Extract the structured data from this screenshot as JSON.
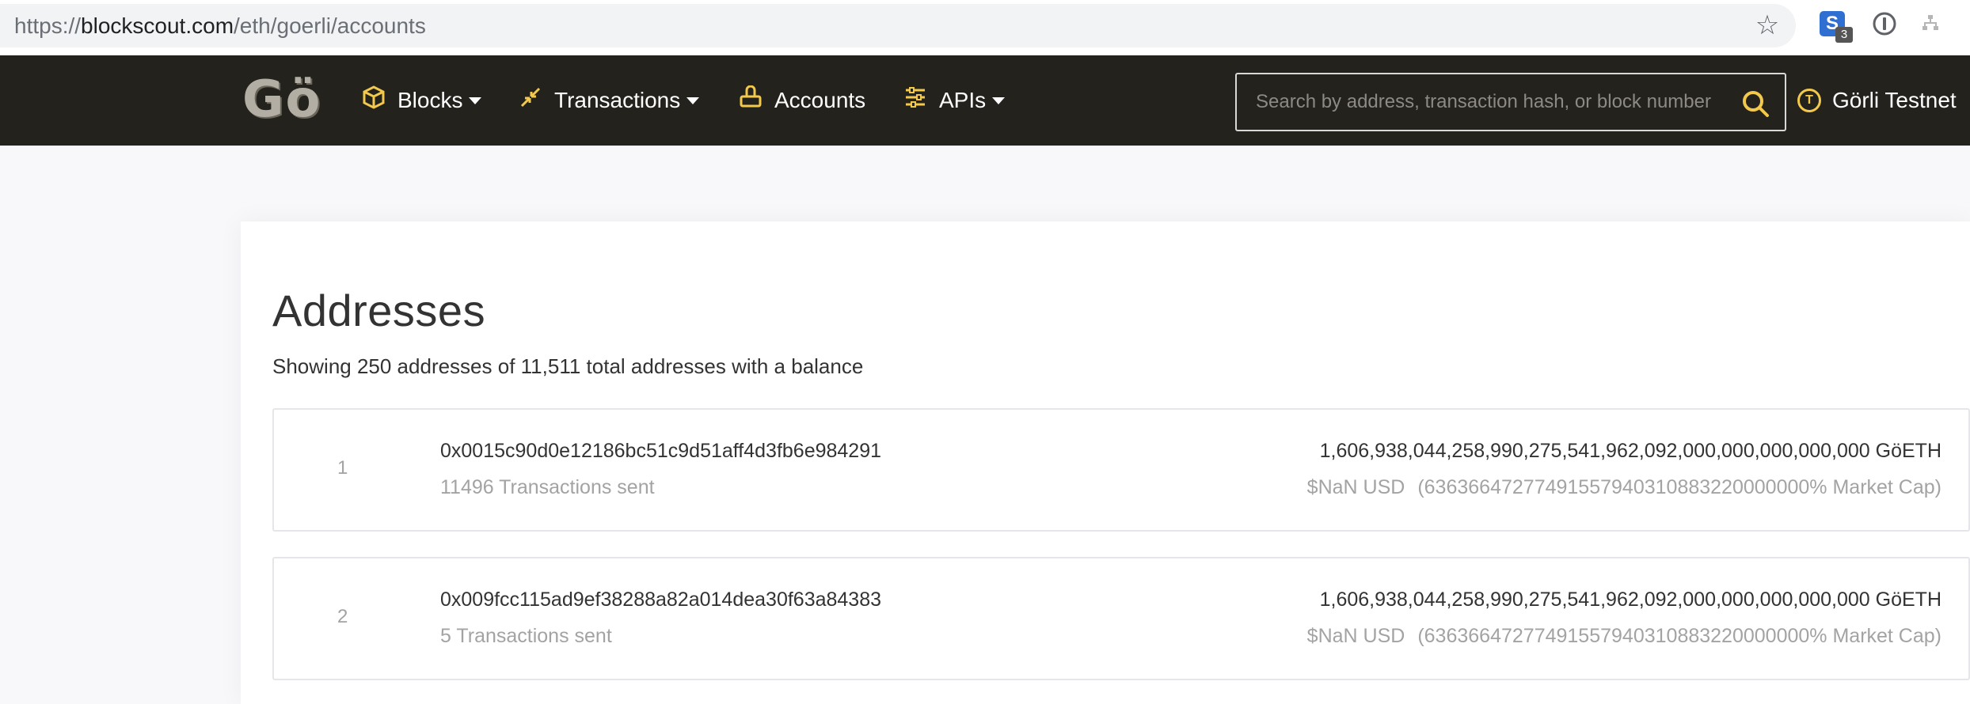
{
  "browser": {
    "url_scheme": "https://",
    "url_host": "blockscout.com",
    "url_path": "/eth/goerli/accounts",
    "extension_badge": "3"
  },
  "nav": {
    "logo": "Gö",
    "blocks": "Blocks",
    "transactions": "Transactions",
    "accounts": "Accounts",
    "apis": "APIs",
    "search_placeholder": "Search by address, transaction hash, or block number",
    "network": "Görli Testnet",
    "network_icon_letter": "T",
    "accent_color": "#f2c94c",
    "bg_color": "#24221d"
  },
  "page": {
    "title": "Addresses",
    "subtitle": "Showing 250 addresses of 11,511 total addresses with a balance"
  },
  "accounts": [
    {
      "rank": "1",
      "address": "0x0015c90d0e12186bc51c9d51aff4d3fb6e984291",
      "tx_sent": "11496 Transactions sent",
      "balance": "1,606,938,044,258,990,275,541,962,092,000,000,000,000,000 GöETH",
      "usd": "$NaN USD",
      "market_cap": "(63636647277491557940310883220000000% Market Cap)"
    },
    {
      "rank": "2",
      "address": "0x009fcc115ad9ef38288a82a014dea30f63a84383",
      "tx_sent": "5 Transactions sent",
      "balance": "1,606,938,044,258,990,275,541,962,092,000,000,000,000,000 GöETH",
      "usd": "$NaN USD",
      "market_cap": "(63636647277491557940310883220000000% Market Cap)"
    }
  ]
}
